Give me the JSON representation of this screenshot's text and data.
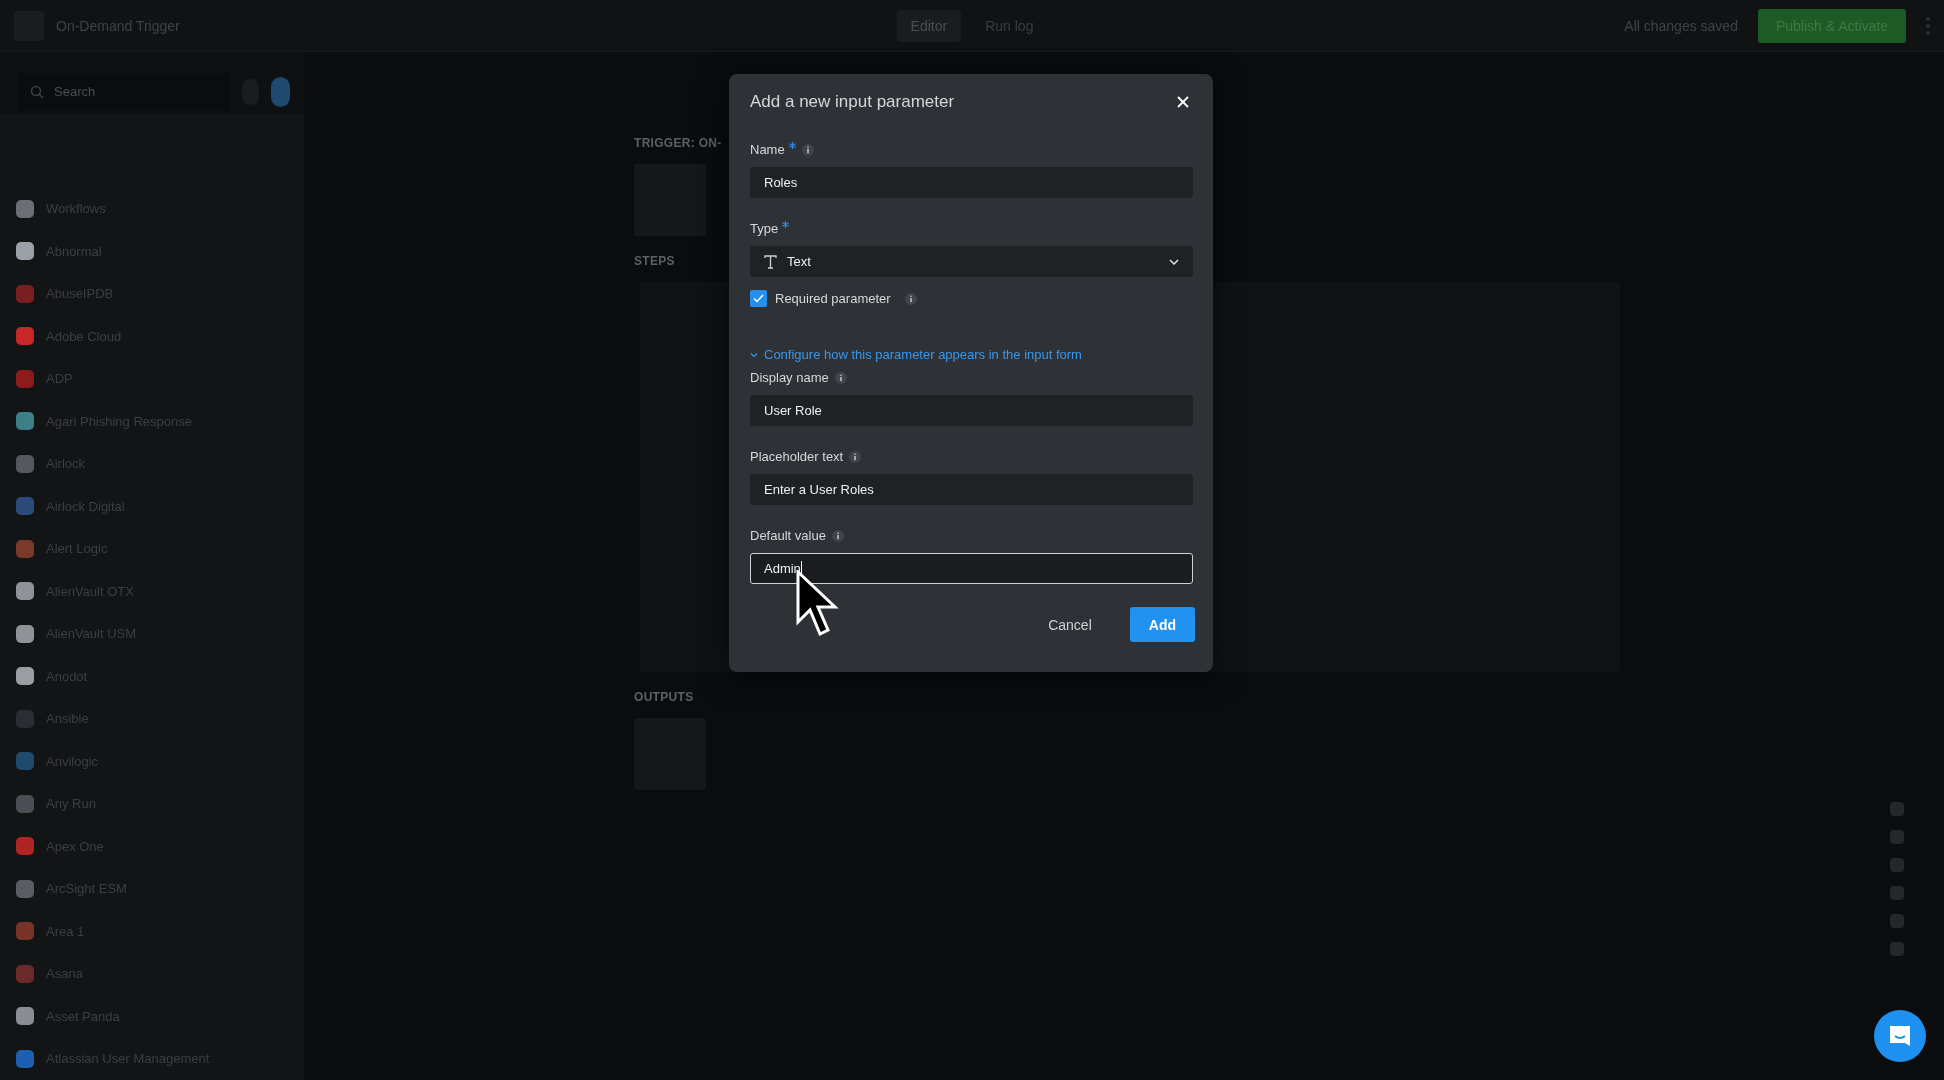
{
  "app_bar": {
    "title": "On-Demand Trigger",
    "tabs": [
      {
        "label": "Editor",
        "selected": true
      },
      {
        "label": "Run log",
        "selected": false
      }
    ],
    "save_status": "All changes saved",
    "publish_button": "Publish & Activate"
  },
  "sidebar": {
    "search": {
      "placeholder": "Search"
    },
    "items": [
      {
        "label": "Workflows",
        "color": "#6b6f75"
      },
      {
        "label": "Abnormal",
        "color": "#9aa0a6"
      },
      {
        "label": "AbuseIPDB",
        "color": "#7a1f1f"
      },
      {
        "label": "Adobe Cloud",
        "color": "#c62828"
      },
      {
        "label": "ADP",
        "color": "#8e1b1b"
      },
      {
        "label": "Agari Phishing Response",
        "color": "#3d7f86"
      },
      {
        "label": "Airlock",
        "color": "#55595f"
      },
      {
        "label": "Airlock Digital",
        "color": "#2d4b7a"
      },
      {
        "label": "Alert Logic",
        "color": "#7a3a2a"
      },
      {
        "label": "AlienVault OTX",
        "color": "#8f9398"
      },
      {
        "label": "AlienVault USM",
        "color": "#8f9398"
      },
      {
        "label": "Anodot",
        "color": "#9a9ea3"
      },
      {
        "label": "Ansible",
        "color": "#2a2d31"
      },
      {
        "label": "Anvilogic",
        "color": "#1f4a6b"
      },
      {
        "label": "Any Run",
        "color": "#4a4e54"
      },
      {
        "label": "Apex One",
        "color": "#b02424"
      },
      {
        "label": "ArcSight ESM",
        "color": "#5a5e64"
      },
      {
        "label": "Area 1",
        "color": "#7a3328"
      },
      {
        "label": "Asana",
        "color": "#6a2a2a"
      },
      {
        "label": "Asset Panda",
        "color": "#8a8e93"
      },
      {
        "label": "Atlassian User Management",
        "color": "#1d5fb0"
      }
    ]
  },
  "canvas": {
    "sections": [
      {
        "label": "TRIGGER: ON-"
      },
      {
        "label": "STEPS"
      },
      {
        "label": "OUTPUTS"
      }
    ]
  },
  "dialog": {
    "title": "Add a new input parameter",
    "fields": [
      {
        "kind": "text",
        "label": "Name",
        "required": true,
        "info": true,
        "value": "Roles",
        "focused": false
      },
      {
        "kind": "select",
        "label": "Type",
        "required": true,
        "value": "Text"
      },
      {
        "kind": "checkbox",
        "label": "Required parameter",
        "info": true,
        "checked": true
      },
      {
        "kind": "toggle",
        "label": "Configure how this parameter appears in the input form",
        "expanded": true
      },
      {
        "kind": "text",
        "label": "Display name",
        "required": false,
        "info": true,
        "value": "User Role",
        "focused": false
      },
      {
        "kind": "text",
        "label": "Placeholder text",
        "required": false,
        "info": true,
        "value": "Enter a User Roles",
        "focused": false
      },
      {
        "kind": "text",
        "label": "Default value",
        "required": false,
        "info": true,
        "value": "Admin",
        "focused": true
      }
    ],
    "buttons": [
      {
        "label": "Cancel",
        "kind": "secondary"
      },
      {
        "label": "Add",
        "kind": "primary"
      }
    ]
  }
}
